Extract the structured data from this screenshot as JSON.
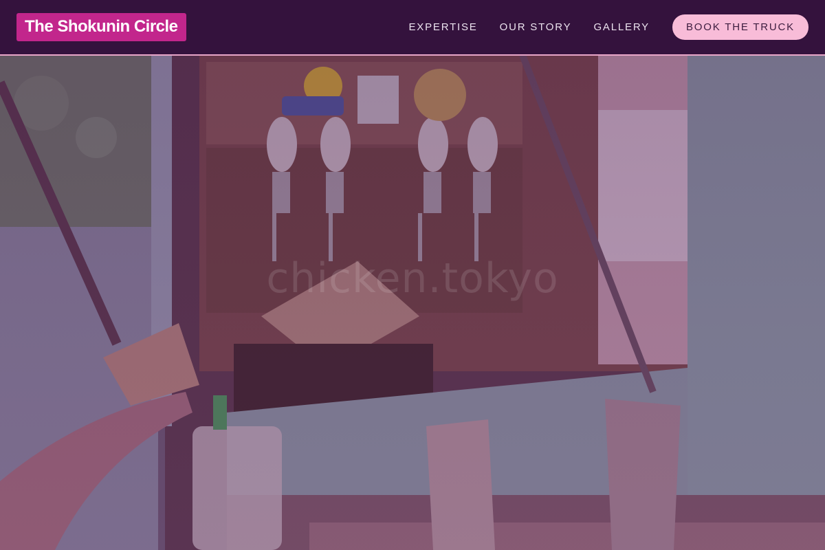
{
  "nav": {
    "brand": "The Shokunin Circle",
    "links": [
      {
        "label": "EXPERTISE"
      },
      {
        "label": "OUR STORY"
      },
      {
        "label": "GALLERY"
      }
    ],
    "cta_label": "BOOK THE TRUCK"
  },
  "hero": {
    "watermark": "chicken.tokyo"
  },
  "colors": {
    "brand_bg": "#c2268c",
    "nav_bg": "#32103c",
    "nav_border": "#e9a6c9",
    "cta_bg": "#f8bcd8",
    "overlay": "#461450"
  }
}
